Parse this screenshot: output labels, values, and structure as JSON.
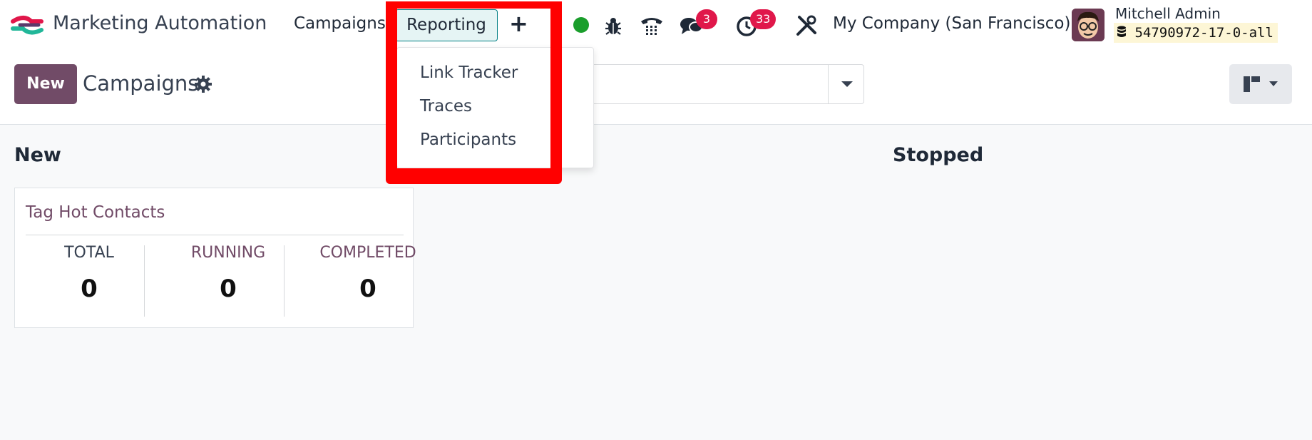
{
  "navbar": {
    "app_name": "Marketing Automation",
    "menus": [
      "Campaigns",
      "Reporting"
    ],
    "add_icon": "+",
    "chat_badge": "3",
    "activity_badge": "33",
    "company": "My Company (San Francisco)",
    "user_name": "Mitchell Admin",
    "db_name": "54790972-17-0-all",
    "icons": [
      "app-logo-icon",
      "status-online-icon",
      "bug-icon",
      "phone-icon",
      "chat-icon",
      "clock-icon",
      "tools-icon",
      "database-icon",
      "avatar-icon"
    ]
  },
  "control_panel": {
    "new_label": "New",
    "breadcrumb": "Campaigns",
    "search_placeholder": ""
  },
  "reporting_dropdown": {
    "items": [
      "Link Tracker",
      "Traces",
      "Participants"
    ]
  },
  "kanban": {
    "columns": [
      {
        "title": "New",
        "cards": [
          {
            "title": "Tag Hot Contacts",
            "stats": [
              {
                "label": "TOTAL",
                "value": "0"
              },
              {
                "label": "RUNNING",
                "value": "0"
              },
              {
                "label": "COMPLETED",
                "value": "0"
              }
            ]
          }
        ]
      },
      {
        "title": "Stopped",
        "cards": []
      }
    ]
  },
  "colors": {
    "brand": "#714b67",
    "accent": "#017e84",
    "badge": "#e0174a",
    "online": "#1a9e2c",
    "highlight": "#ff0000"
  }
}
